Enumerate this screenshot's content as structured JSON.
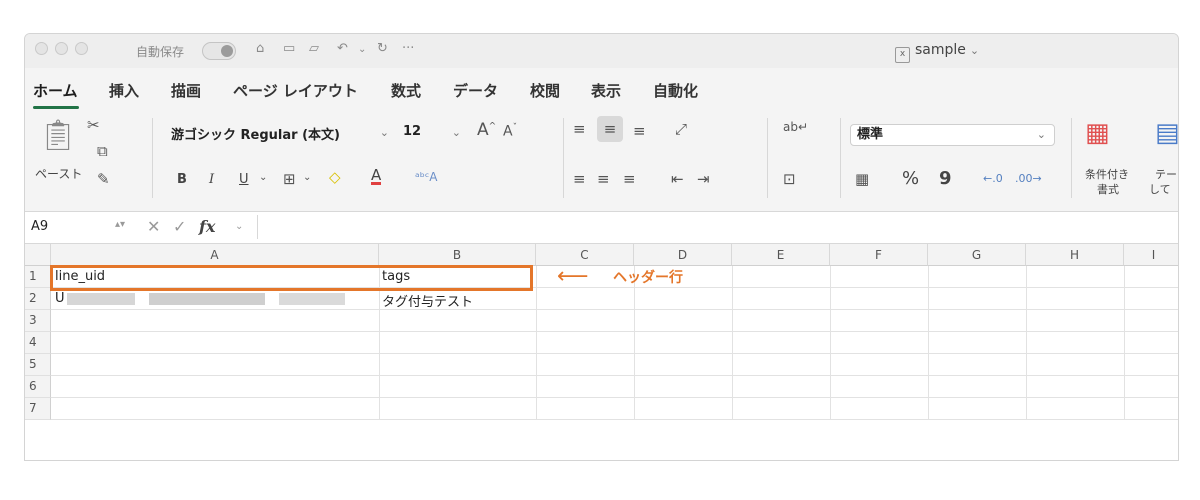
{
  "titlebar": {
    "autosave_label": "自動保存",
    "more": "···",
    "doc_title": "sample",
    "doc_icon": "x"
  },
  "tabs": [
    "ホーム",
    "挿入",
    "描画",
    "ページ レイアウト",
    "数式",
    "データ",
    "校閲",
    "表示",
    "自動化"
  ],
  "ribbon": {
    "paste_label": "ペースト",
    "font_name": "游ゴシック Regular (本文)",
    "font_size": "12",
    "bold": "B",
    "italic": "I",
    "underline": "U",
    "number_format": "標準",
    "percent": "%",
    "comma": "9",
    "cond_format_label_1": "条件付き",
    "cond_format_label_2": "書式",
    "table_label_1": "テー",
    "table_label_2": "して"
  },
  "formula_bar": {
    "name_box": "A9",
    "fx": "fx",
    "value": ""
  },
  "grid": {
    "columns": [
      "A",
      "B",
      "C",
      "D",
      "E",
      "F",
      "G",
      "H",
      "I"
    ],
    "rows": [
      "1",
      "2",
      "3",
      "4",
      "5",
      "6",
      "7"
    ],
    "cells": {
      "A1": "line_uid",
      "B1": "tags",
      "A2": "U",
      "B2": "タグ付与テスト"
    }
  },
  "annotation": {
    "arrow": "⟵",
    "text": "ヘッダー行",
    "color": "#e4762a"
  },
  "colors": {
    "accent": "#217346",
    "highlight": "#e4762a"
  }
}
